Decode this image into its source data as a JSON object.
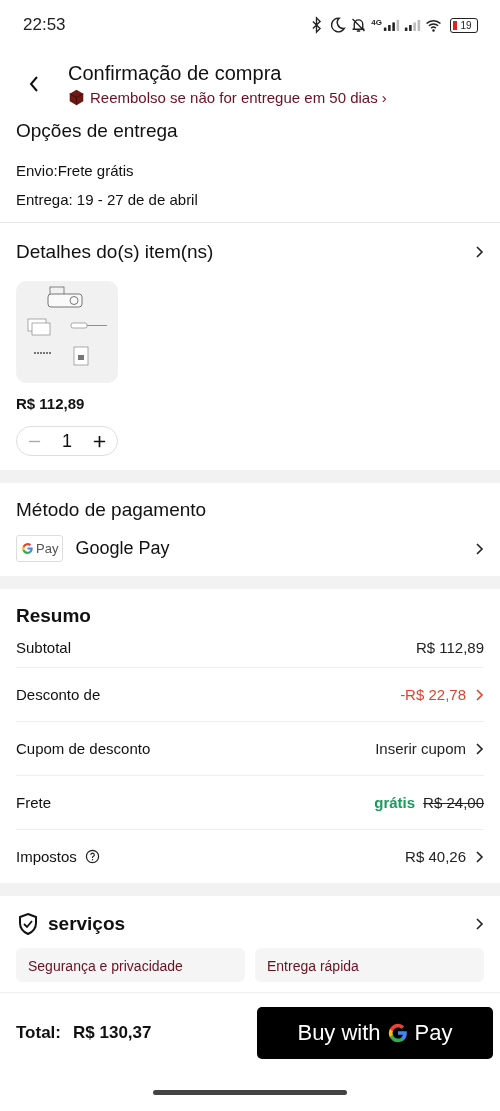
{
  "status_bar": {
    "time": "22:53",
    "network": "4G",
    "battery": "19"
  },
  "header": {
    "title": "Confirmação de compra",
    "notice": "Reembolso se não for entregue em 50 dias ›"
  },
  "delivery": {
    "title": "Opções de entrega",
    "shipping": "Envio:Frete grátis",
    "date": "Entrega: 19 - 27 de de abril"
  },
  "items": {
    "title": "Detalhes do(s) item(ns)",
    "products": [
      {
        "kind": "picture",
        "price": "R$ 112,89",
        "quantity": "1"
      }
    ]
  },
  "payment": {
    "title": "Método de pagamento",
    "badge": "Pay",
    "method": "Google Pay"
  },
  "summary": {
    "title": "Resumo",
    "rows": [
      {
        "label": "Subtotal",
        "value": "R$ 112,89",
        "color": "#222222",
        "chevron": false,
        "info": false
      },
      {
        "label": "Desconto de",
        "value": "-R$ 22,78",
        "color": "#e0432b",
        "chevron": true,
        "info": false
      },
      {
        "label": "Cupom de desconto",
        "value": "Inserir cupom",
        "color": "#222222",
        "chevron": true,
        "info": false
      },
      {
        "label": "Frete",
        "value": "grátis",
        "original": "R$ 24,00",
        "color": "#1a9a5b",
        "chevron": false,
        "info": false
      },
      {
        "label": "Impostos",
        "value": "R$ 40,26",
        "color": "#222222",
        "chevron": true,
        "info": true
      }
    ]
  },
  "services": {
    "title": "serviços",
    "cards": [
      "Segurança e privacidade",
      "Entrega rápida"
    ]
  },
  "footer": {
    "total_label": "Total:",
    "total": "R$ 130,37",
    "button_before": "Buy with",
    "button_after": "Pay"
  }
}
